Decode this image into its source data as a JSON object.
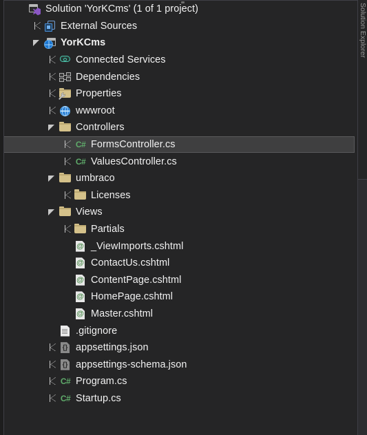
{
  "panel": {
    "dock_tab_label": "Solution Explorer"
  },
  "colors": {
    "background": "#252526",
    "selected_row": "#3f3f40",
    "selected_border": "#5a5a5c",
    "text": "#f1f1f1",
    "folder": "#d4c18a",
    "csharp_green": "#5faa6a",
    "globe_blue": "#1b76d1",
    "cloud_teal": "#4ec9b0",
    "vs_purple": "#8a56c4",
    "frame": "#3f3f46"
  },
  "tree": [
    {
      "label": "Solution 'YorKCms' (1 of 1 project)",
      "icon": "solution-icon",
      "depth": 0,
      "expander": "none",
      "bold": false,
      "selected": false
    },
    {
      "label": "External Sources",
      "icon": "external-sources-icon",
      "depth": 1,
      "expander": "collapsed",
      "bold": false,
      "selected": false
    },
    {
      "label": "YorKCms",
      "icon": "project-icon",
      "depth": 1,
      "expander": "expanded",
      "bold": true,
      "selected": false
    },
    {
      "label": "Connected Services",
      "icon": "cloud-icon",
      "depth": 2,
      "expander": "collapsed",
      "bold": false,
      "selected": false
    },
    {
      "label": "Dependencies",
      "icon": "dependencies-icon",
      "depth": 2,
      "expander": "collapsed",
      "bold": false,
      "selected": false
    },
    {
      "label": "Properties",
      "icon": "properties-folder-icon",
      "depth": 2,
      "expander": "collapsed",
      "bold": false,
      "selected": false
    },
    {
      "label": "wwwroot",
      "icon": "globe-icon",
      "depth": 2,
      "expander": "collapsed",
      "bold": false,
      "selected": false
    },
    {
      "label": "Controllers",
      "icon": "folder-icon",
      "depth": 2,
      "expander": "expanded",
      "bold": false,
      "selected": false
    },
    {
      "label": "FormsController.cs",
      "icon": "csharp-file-icon",
      "depth": 3,
      "expander": "collapsed",
      "bold": false,
      "selected": true
    },
    {
      "label": "ValuesController.cs",
      "icon": "csharp-file-icon",
      "depth": 3,
      "expander": "collapsed",
      "bold": false,
      "selected": false
    },
    {
      "label": "umbraco",
      "icon": "folder-icon",
      "depth": 2,
      "expander": "expanded",
      "bold": false,
      "selected": false
    },
    {
      "label": "Licenses",
      "icon": "folder-icon",
      "depth": 3,
      "expander": "collapsed",
      "bold": false,
      "selected": false
    },
    {
      "label": "Views",
      "icon": "folder-icon",
      "depth": 2,
      "expander": "expanded",
      "bold": false,
      "selected": false
    },
    {
      "label": "Partials",
      "icon": "folder-icon",
      "depth": 3,
      "expander": "collapsed",
      "bold": false,
      "selected": false
    },
    {
      "label": "_ViewImports.cshtml",
      "icon": "cshtml-file-icon",
      "depth": 3,
      "expander": "none",
      "bold": false,
      "selected": false
    },
    {
      "label": "ContactUs.cshtml",
      "icon": "cshtml-file-icon",
      "depth": 3,
      "expander": "none",
      "bold": false,
      "selected": false
    },
    {
      "label": "ContentPage.cshtml",
      "icon": "cshtml-file-icon",
      "depth": 3,
      "expander": "none",
      "bold": false,
      "selected": false
    },
    {
      "label": "HomePage.cshtml",
      "icon": "cshtml-file-icon",
      "depth": 3,
      "expander": "none",
      "bold": false,
      "selected": false
    },
    {
      "label": "Master.cshtml",
      "icon": "cshtml-file-icon",
      "depth": 3,
      "expander": "none",
      "bold": false,
      "selected": false
    },
    {
      "label": ".gitignore",
      "icon": "text-file-icon",
      "depth": 2,
      "expander": "none",
      "bold": false,
      "selected": false
    },
    {
      "label": "appsettings.json",
      "icon": "json-file-icon",
      "depth": 2,
      "expander": "collapsed",
      "bold": false,
      "selected": false
    },
    {
      "label": "appsettings-schema.json",
      "icon": "json-file-icon",
      "depth": 2,
      "expander": "collapsed",
      "bold": false,
      "selected": false
    },
    {
      "label": "Program.cs",
      "icon": "csharp-file-icon",
      "depth": 2,
      "expander": "collapsed",
      "bold": false,
      "selected": false
    },
    {
      "label": "Startup.cs",
      "icon": "csharp-file-icon",
      "depth": 2,
      "expander": "collapsed",
      "bold": false,
      "selected": false
    }
  ]
}
